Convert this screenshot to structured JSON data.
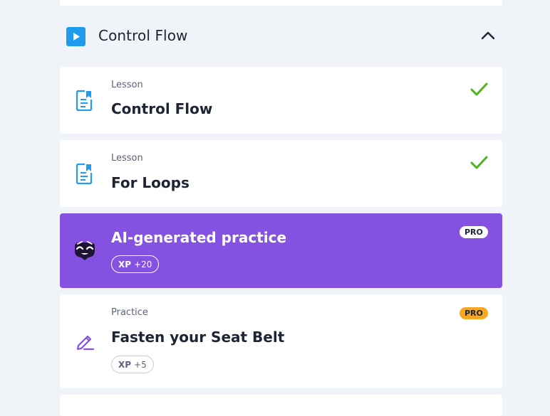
{
  "section": {
    "title": "Control Flow",
    "icon": "play-icon",
    "collapse_icon": "chevron-up-icon",
    "accent": "#1f9cf0"
  },
  "items": [
    {
      "kicker": "Lesson",
      "title": "Control Flow",
      "icon": "lesson-document-icon",
      "status": "completed"
    },
    {
      "kicker": "Lesson",
      "title": "For Loops",
      "icon": "lesson-document-icon",
      "status": "completed"
    },
    {
      "title": "AI-generated practice",
      "badge": "PRO",
      "xp_label": "XP",
      "xp_value": "+20",
      "icon": "ai-mascot-icon",
      "background": "#8551e0"
    },
    {
      "kicker": "Practice",
      "title": "Fasten your Seat Belt",
      "badge": "PRO",
      "xp_label": "XP",
      "xp_value": "+5",
      "icon": "pencil-edit-icon",
      "badge_color": "#f7a823"
    }
  ],
  "colors": {
    "check": "#4cb51a",
    "text_dark": "#1d2433",
    "purple": "#8551e0",
    "pro_orange": "#f7a823"
  }
}
